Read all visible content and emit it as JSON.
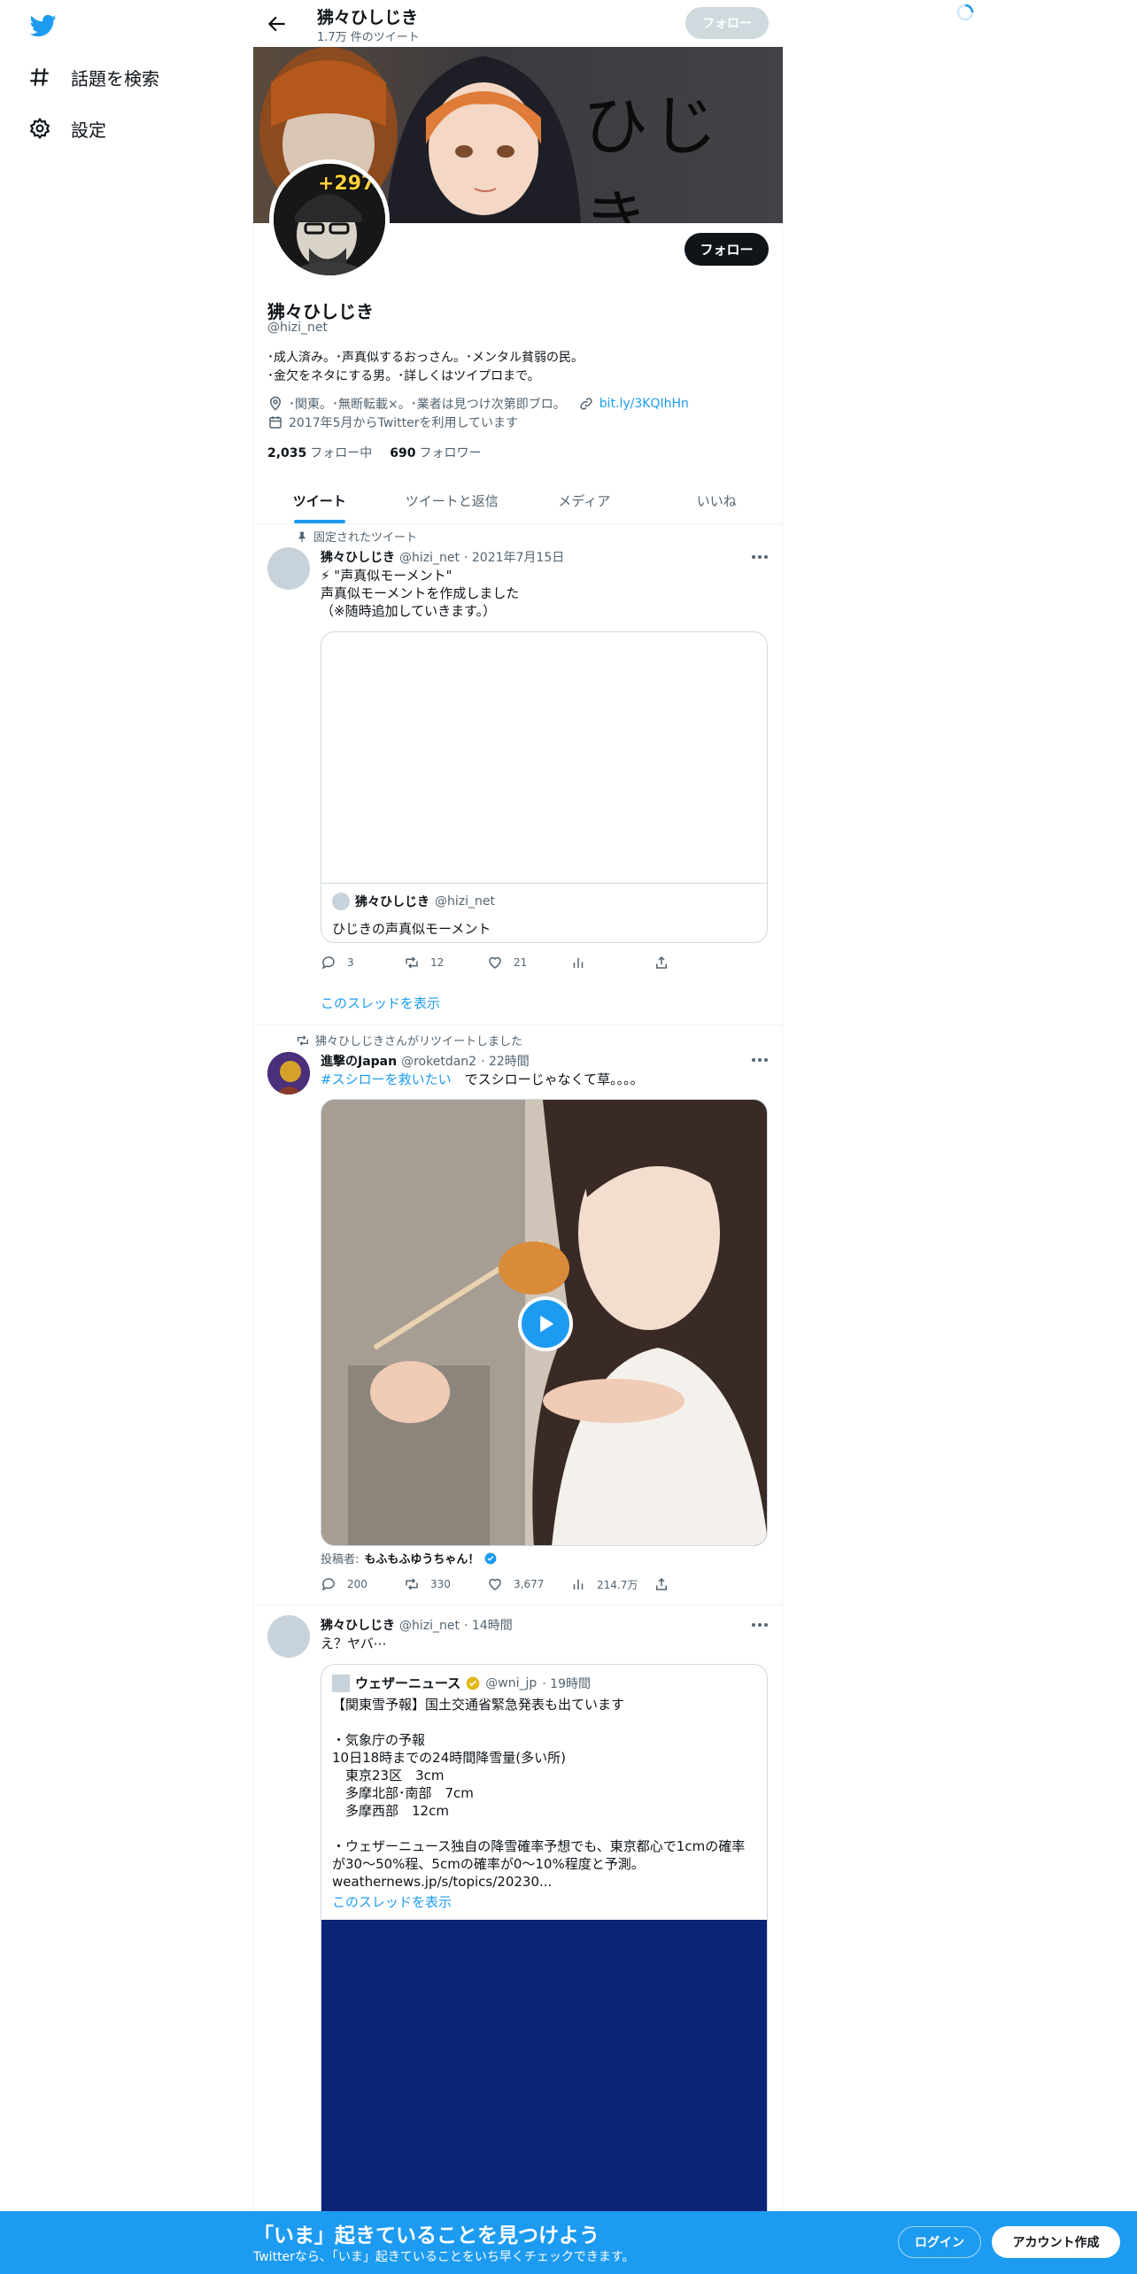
{
  "nav": {
    "logo_icon": "twitter-bird-icon",
    "items": [
      {
        "label": "話題を検索",
        "icon": "hashtag-icon"
      },
      {
        "label": "設定",
        "icon": "gear-icon"
      }
    ]
  },
  "header": {
    "name": "狒々ひしじき",
    "tweet_count": "1.7万 件のツイート",
    "follow_label": "フォロー"
  },
  "banner": {
    "calligraphy_text": "ひじき"
  },
  "profile": {
    "badge": "+297",
    "follow_label": "フォロー",
    "name": "狒々ひしじき",
    "handle": "@hizi_net",
    "bio": "･成人済み。･声真似するおっさん。･メンタル貧弱の民。\n･金欠をネタにする男。･詳しくはツイプロまで。",
    "location": "･関東。･無断転載×。･業者は見つけ次第即ブロ。",
    "url": "bit.ly/3KQIhHn",
    "joined": "2017年5月からTwitterを利用しています",
    "following_count": "2,035",
    "following_label": "フォロー中",
    "followers_count": "690",
    "followers_label": "フォロワー"
  },
  "tabs": [
    "ツイート",
    "ツイートと返信",
    "メディア",
    "いいね"
  ],
  "tweets": [
    {
      "social": "固定されたツイート",
      "name": "狒々ひしじき",
      "handle": "@hizi_net",
      "time": "· 2021年7月15日",
      "text": "⚡ \"声真似モーメント\"\n声真似モーメントを作成しました\n（※随時追加していきます。）",
      "card": {
        "name": "狒々ひしじき",
        "handle": "@hizi_net",
        "title": "ひじきの声真似モーメント"
      },
      "replies": "3",
      "retweets": "12",
      "likes": "21",
      "thread_link": "このスレッドを表示"
    },
    {
      "social": "狒々ひしじきさんがリツイートしました",
      "name": "進撃のJapan",
      "handle": "@roketdan2",
      "time": "· 22時間",
      "hashtag": "#スシローを救いたい",
      "text": "　でスシローじゃなくて草。。。。",
      "poster_prefix": "投稿者:",
      "poster_name": "もふもふゆうちゃん！",
      "replies": "200",
      "retweets": "330",
      "likes": "3,677",
      "views": "214.7万"
    },
    {
      "name": "狒々ひしじき",
      "handle": "@hizi_net",
      "time": "· 14時間",
      "text": "え？ヤバ⋯",
      "quote": {
        "name": "ウェザーニュース",
        "handle": "@wni_jp",
        "time": "· 19時間",
        "text": "【関東雪予報】国土交通省緊急発表も出ています\n\n・気象庁の予報\n10日18時までの24時間降雪量(多い所)\n　東京23区　3cm\n　多摩北部･南部　7cm\n　多摩西部　12cm\n\n・ウェザーニュース独自の降雪確率予想でも、東京都心で1cmの確率が30〜50%程、5cmの確率が0〜10%程度と予測。\nweathernews.jp/s/topics/20230...",
        "thread_link": "このスレッドを表示"
      }
    }
  ],
  "bottom": {
    "title": "「いま」起きていることを見つけよう",
    "subtitle": "Twitterなら、「いま」起きていることをいち早くチェックできます。",
    "login": "ログイン",
    "signup": "アカウント作成"
  },
  "colors": {
    "accent": "#1d9bf0",
    "text": "#0f1419",
    "muted": "#536471",
    "quote_media": "#0c2476"
  }
}
